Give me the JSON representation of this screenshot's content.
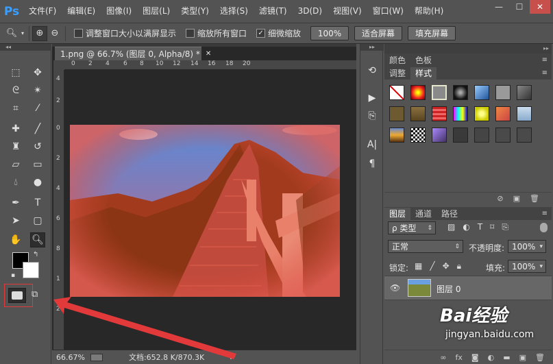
{
  "app": {
    "logo": "Ps"
  },
  "menu": [
    "文件(F)",
    "编辑(E)",
    "图像(I)",
    "图层(L)",
    "类型(Y)",
    "选择(S)",
    "滤镜(T)",
    "3D(D)",
    "视图(V)",
    "窗口(W)",
    "帮助(H)"
  ],
  "window_controls": {
    "minimize": "—",
    "maximize": "☐",
    "close": "✕"
  },
  "options": {
    "check1": "调整窗口大小以满屏显示",
    "check2": "缩放所有窗口",
    "check3": "细微缩放",
    "zoom_btn": "100%",
    "fit_btn": "适合屏幕",
    "fill_btn": "填充屏幕"
  },
  "document": {
    "tab_title": "1.png @ 66.7% (图层 0, Alpha/8) *",
    "tab_close": "✕",
    "ruler_h": [
      "0",
      "2",
      "4",
      "6",
      "8",
      "10",
      "12",
      "14",
      "16",
      "18",
      "20"
    ],
    "ruler_v": [
      "4",
      "2",
      "0",
      "2",
      "4",
      "6",
      "8",
      "1",
      "2"
    ]
  },
  "status": {
    "zoom": "66.67%",
    "doc": "文档:652.8 K/870.3K"
  },
  "styles_panel": {
    "tabs": [
      "颜色",
      "色板",
      "调整",
      "样式"
    ]
  },
  "layers_panel": {
    "tabs": [
      "图层",
      "通道",
      "路径"
    ],
    "filter": "ρ 类型",
    "blend": "正常",
    "opacity_label": "不透明度:",
    "opacity": "100%",
    "lock_label": "锁定:",
    "fill_label": "填充:",
    "fill": "100%",
    "layer_name": "图层 0"
  },
  "watermark": {
    "brand": "Bai经验",
    "url": "jingyan.baidu.com"
  },
  "colors": {
    "accent": "#3a9eff",
    "bg": "#535353",
    "doc_bg": "#282828",
    "arrow": "#e23a3a"
  }
}
